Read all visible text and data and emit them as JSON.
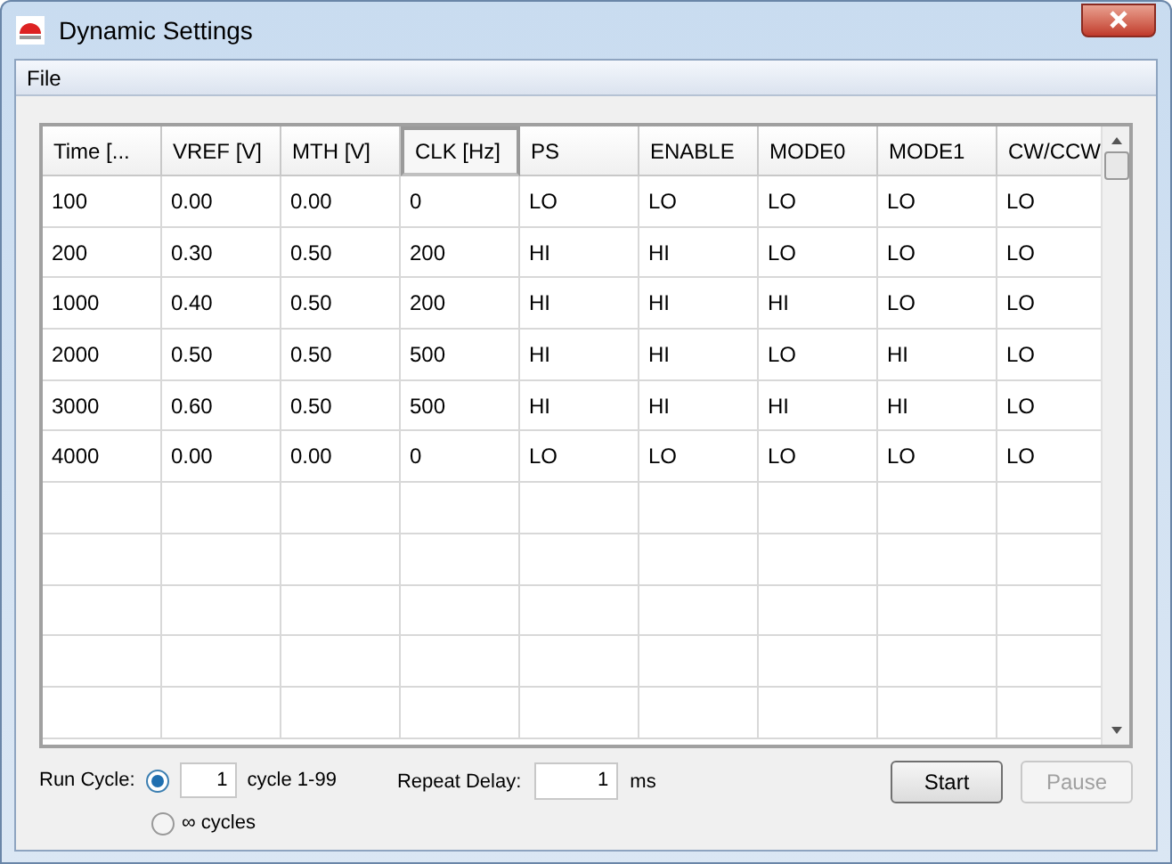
{
  "window": {
    "title": "Dynamic Settings"
  },
  "menu": [
    "File"
  ],
  "table": {
    "columns": [
      {
        "label": "Time [...",
        "selected": false
      },
      {
        "label": "VREF [V]",
        "selected": false
      },
      {
        "label": "MTH [V]",
        "selected": false
      },
      {
        "label": "CLK [Hz]",
        "selected": true
      },
      {
        "label": "PS",
        "selected": false
      },
      {
        "label": "ENABLE",
        "selected": false
      },
      {
        "label": "MODE0",
        "selected": false
      },
      {
        "label": "MODE1",
        "selected": false
      },
      {
        "label": "CW/CCW",
        "selected": false
      }
    ],
    "rows": [
      [
        "100",
        "0.00",
        "0.00",
        "0",
        "LO",
        "LO",
        "LO",
        "LO",
        "LO"
      ],
      [
        "200",
        "0.30",
        "0.50",
        "200",
        "HI",
        "HI",
        "LO",
        "LO",
        "LO"
      ],
      [
        "1000",
        "0.40",
        "0.50",
        "200",
        "HI",
        "HI",
        "HI",
        "LO",
        "LO"
      ],
      [
        "2000",
        "0.50",
        "0.50",
        "500",
        "HI",
        "HI",
        "LO",
        "HI",
        "LO"
      ],
      [
        "3000",
        "0.60",
        "0.50",
        "500",
        "HI",
        "HI",
        "HI",
        "HI",
        "LO"
      ],
      [
        "4000",
        "0.00",
        "0.00",
        "0",
        "LO",
        "LO",
        "LO",
        "LO",
        "LO"
      ]
    ]
  },
  "run_cycle": {
    "label": "Run Cycle:",
    "options": [
      {
        "kind": "count",
        "selected": true,
        "value": "1",
        "suffix": "cycle 1-99"
      },
      {
        "kind": "infinite",
        "selected": false,
        "label": "∞ cycles"
      }
    ]
  },
  "repeat_delay": {
    "label": "Repeat Delay:",
    "value": "1",
    "unit": "ms"
  },
  "buttons": [
    {
      "label": "Start",
      "disabled": false
    },
    {
      "label": "Pause",
      "disabled": true
    }
  ]
}
